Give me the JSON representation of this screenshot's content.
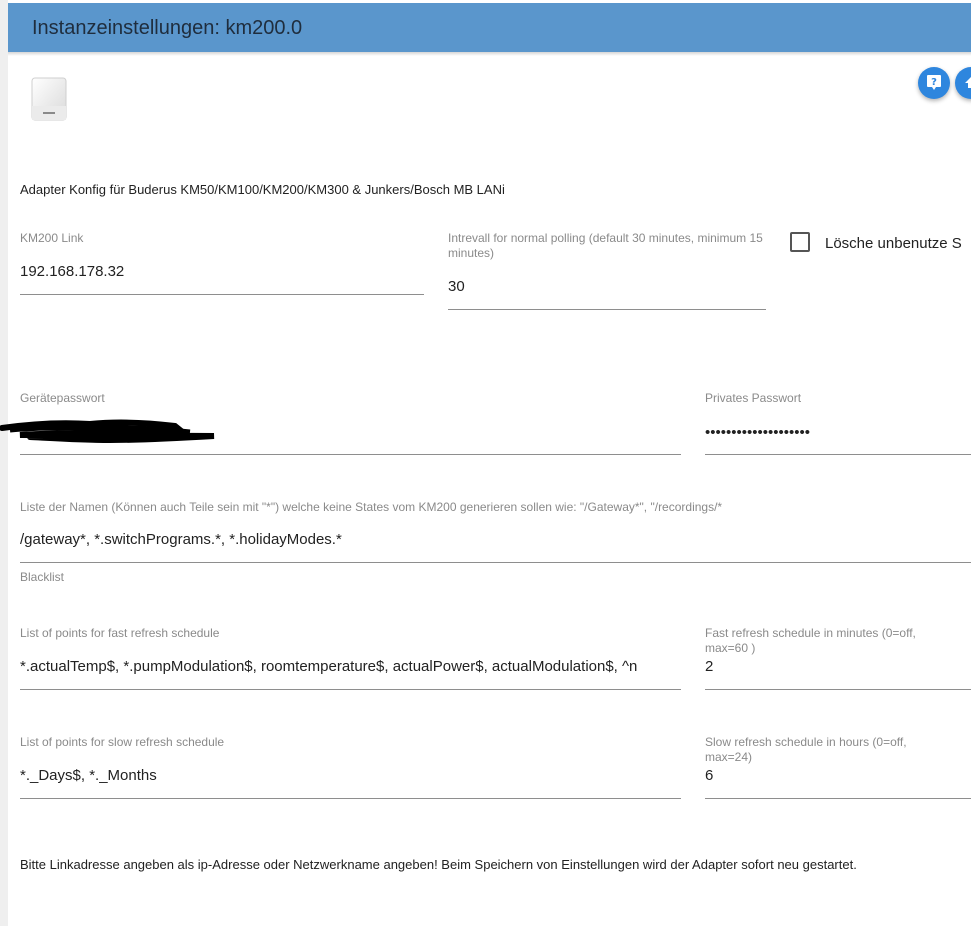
{
  "header": {
    "title": "Instanzeinstellungen: km200.0"
  },
  "icons": {
    "logo": "device-icon",
    "help": "help-icon",
    "upload": "upload-icon"
  },
  "colors": {
    "header_bg": "#5a96cc",
    "button_bg": "#2e86de"
  },
  "intro": "Adapter Konfig für Buderus KM50/KM100/KM200/KM300 & Junkers/Bosch MB LANi",
  "fields": {
    "km200_link": {
      "label": "KM200 Link",
      "value": "192.168.178.32"
    },
    "interval": {
      "label": "Intrevall for normal polling (default 30 minutes, minimum 15 minutes)",
      "value": "30"
    },
    "delete_unused": {
      "label": "Lösche unbenutze S",
      "checked": false
    },
    "device_password": {
      "label": "Gerätepasswort",
      "value": ""
    },
    "private_password": {
      "label": "Privates Passwort",
      "value": "••••••••••••••••••••"
    },
    "blacklist": {
      "label": "Liste der Namen (Können auch Teile sein mit \"*\") welche keine States vom KM200 generieren sollen wie: \"/Gateway*\", \"/recordings/*",
      "value": "/gateway*, *.switchPrograms.*, *.holidayModes.*",
      "helper": "Blacklist"
    },
    "fast_points": {
      "label": "List of points for fast refresh schedule",
      "value": "*.actualTemp$, *.pumpModulation$, roomtemperature$, actualPower$, actualModulation$, ^n"
    },
    "fast_minutes": {
      "label": "Fast refresh schedule in minutes (0=off, max=60 )",
      "value": "2"
    },
    "slow_points": {
      "label": "List of points for slow refresh schedule",
      "value": "*._Days$, *._Months"
    },
    "slow_hours": {
      "label": "Slow refresh schedule in hours (0=off, max=24)",
      "value": "6"
    }
  },
  "footer_note": "Bitte Linkadresse angeben als ip-Adresse oder Netzwerkname angeben! Beim Speichern von Einstellungen wird der Adapter sofort neu gestartet."
}
